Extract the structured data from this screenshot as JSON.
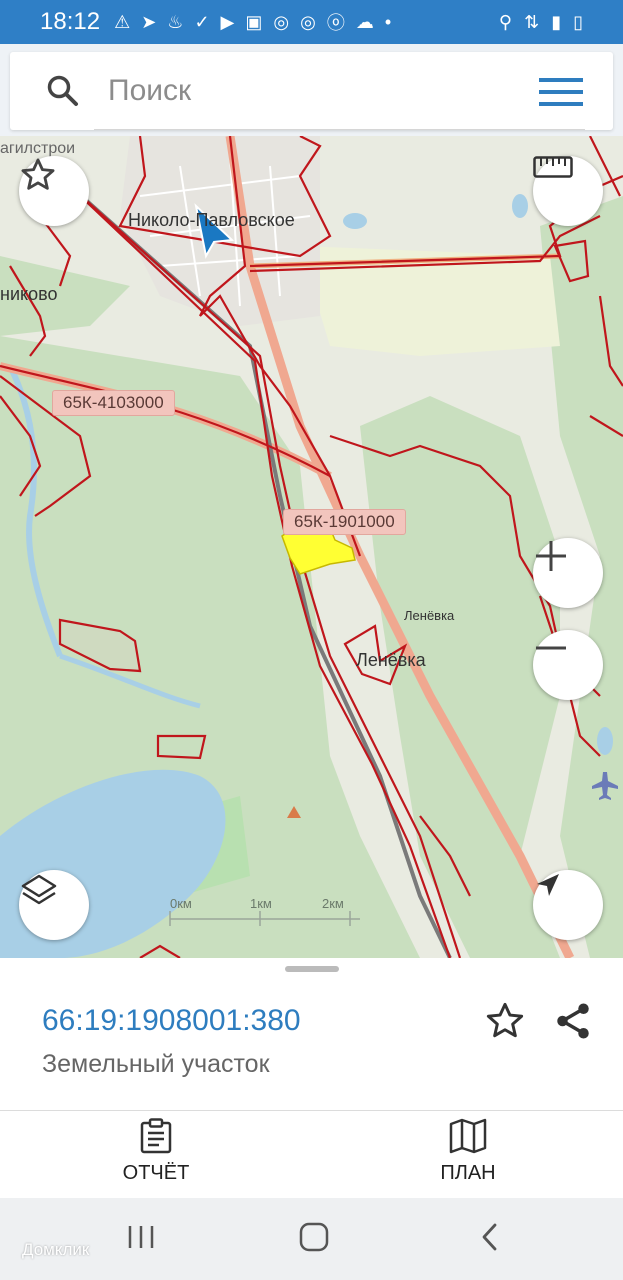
{
  "status_bar": {
    "time": "18:12",
    "icons": [
      "warning-icon",
      "telegram-icon",
      "fire-icon",
      "check-icon",
      "youtube-icon",
      "lukoil-icon",
      "chrome-icon",
      "chrome-icon",
      "ok-icon",
      "cloud-icon",
      "dot-icon"
    ],
    "right_icons": [
      "location-icon",
      "network-icon",
      "signal-icon",
      "battery-icon"
    ]
  },
  "search": {
    "placeholder": "Поиск"
  },
  "map": {
    "labels": {
      "town1": "Николо-Павловское",
      "town2": "никово",
      "town3": "агилстрои",
      "village": "Ленёвка",
      "village_small": "Ленёвка"
    },
    "road_labels": {
      "road1": "65К-4103000",
      "road2": "65К-1901000"
    },
    "scale": {
      "s1": "0км",
      "s2": "1км",
      "s3": "2км"
    },
    "colors": {
      "forest": "#c9dfbf",
      "water": "#a8cfe6",
      "boundary": "#c0161c",
      "highway": "#f0a890",
      "selected_parcel": "#ffff33"
    }
  },
  "parcel": {
    "cadastral_number": "66:19:1908001:380",
    "type": "Земельный участок"
  },
  "actions": {
    "report": "ОТЧЁТ",
    "plan": "ПЛАН"
  },
  "watermark": "Домклик"
}
